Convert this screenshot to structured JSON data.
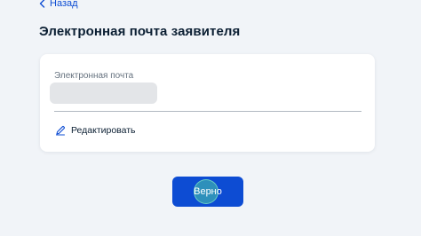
{
  "navigation": {
    "back_label": "Назад",
    "back_icon": "chevron-left-icon"
  },
  "page": {
    "title": "Электронная почта заявителя"
  },
  "email_card": {
    "field_label": "Электронная почта",
    "field_value_state": "hidden",
    "edit_label": "Редактировать",
    "edit_icon": "pencil-icon"
  },
  "actions": {
    "confirm_label": "Верно"
  },
  "colors": {
    "accent": "#0d4cd3",
    "background": "#f1f4f8",
    "card": "#ffffff",
    "text_primary": "#0b1f33",
    "text_secondary": "#66727f",
    "redaction": "#e3e5e8",
    "touch_indicator": "#4ac8a8"
  }
}
